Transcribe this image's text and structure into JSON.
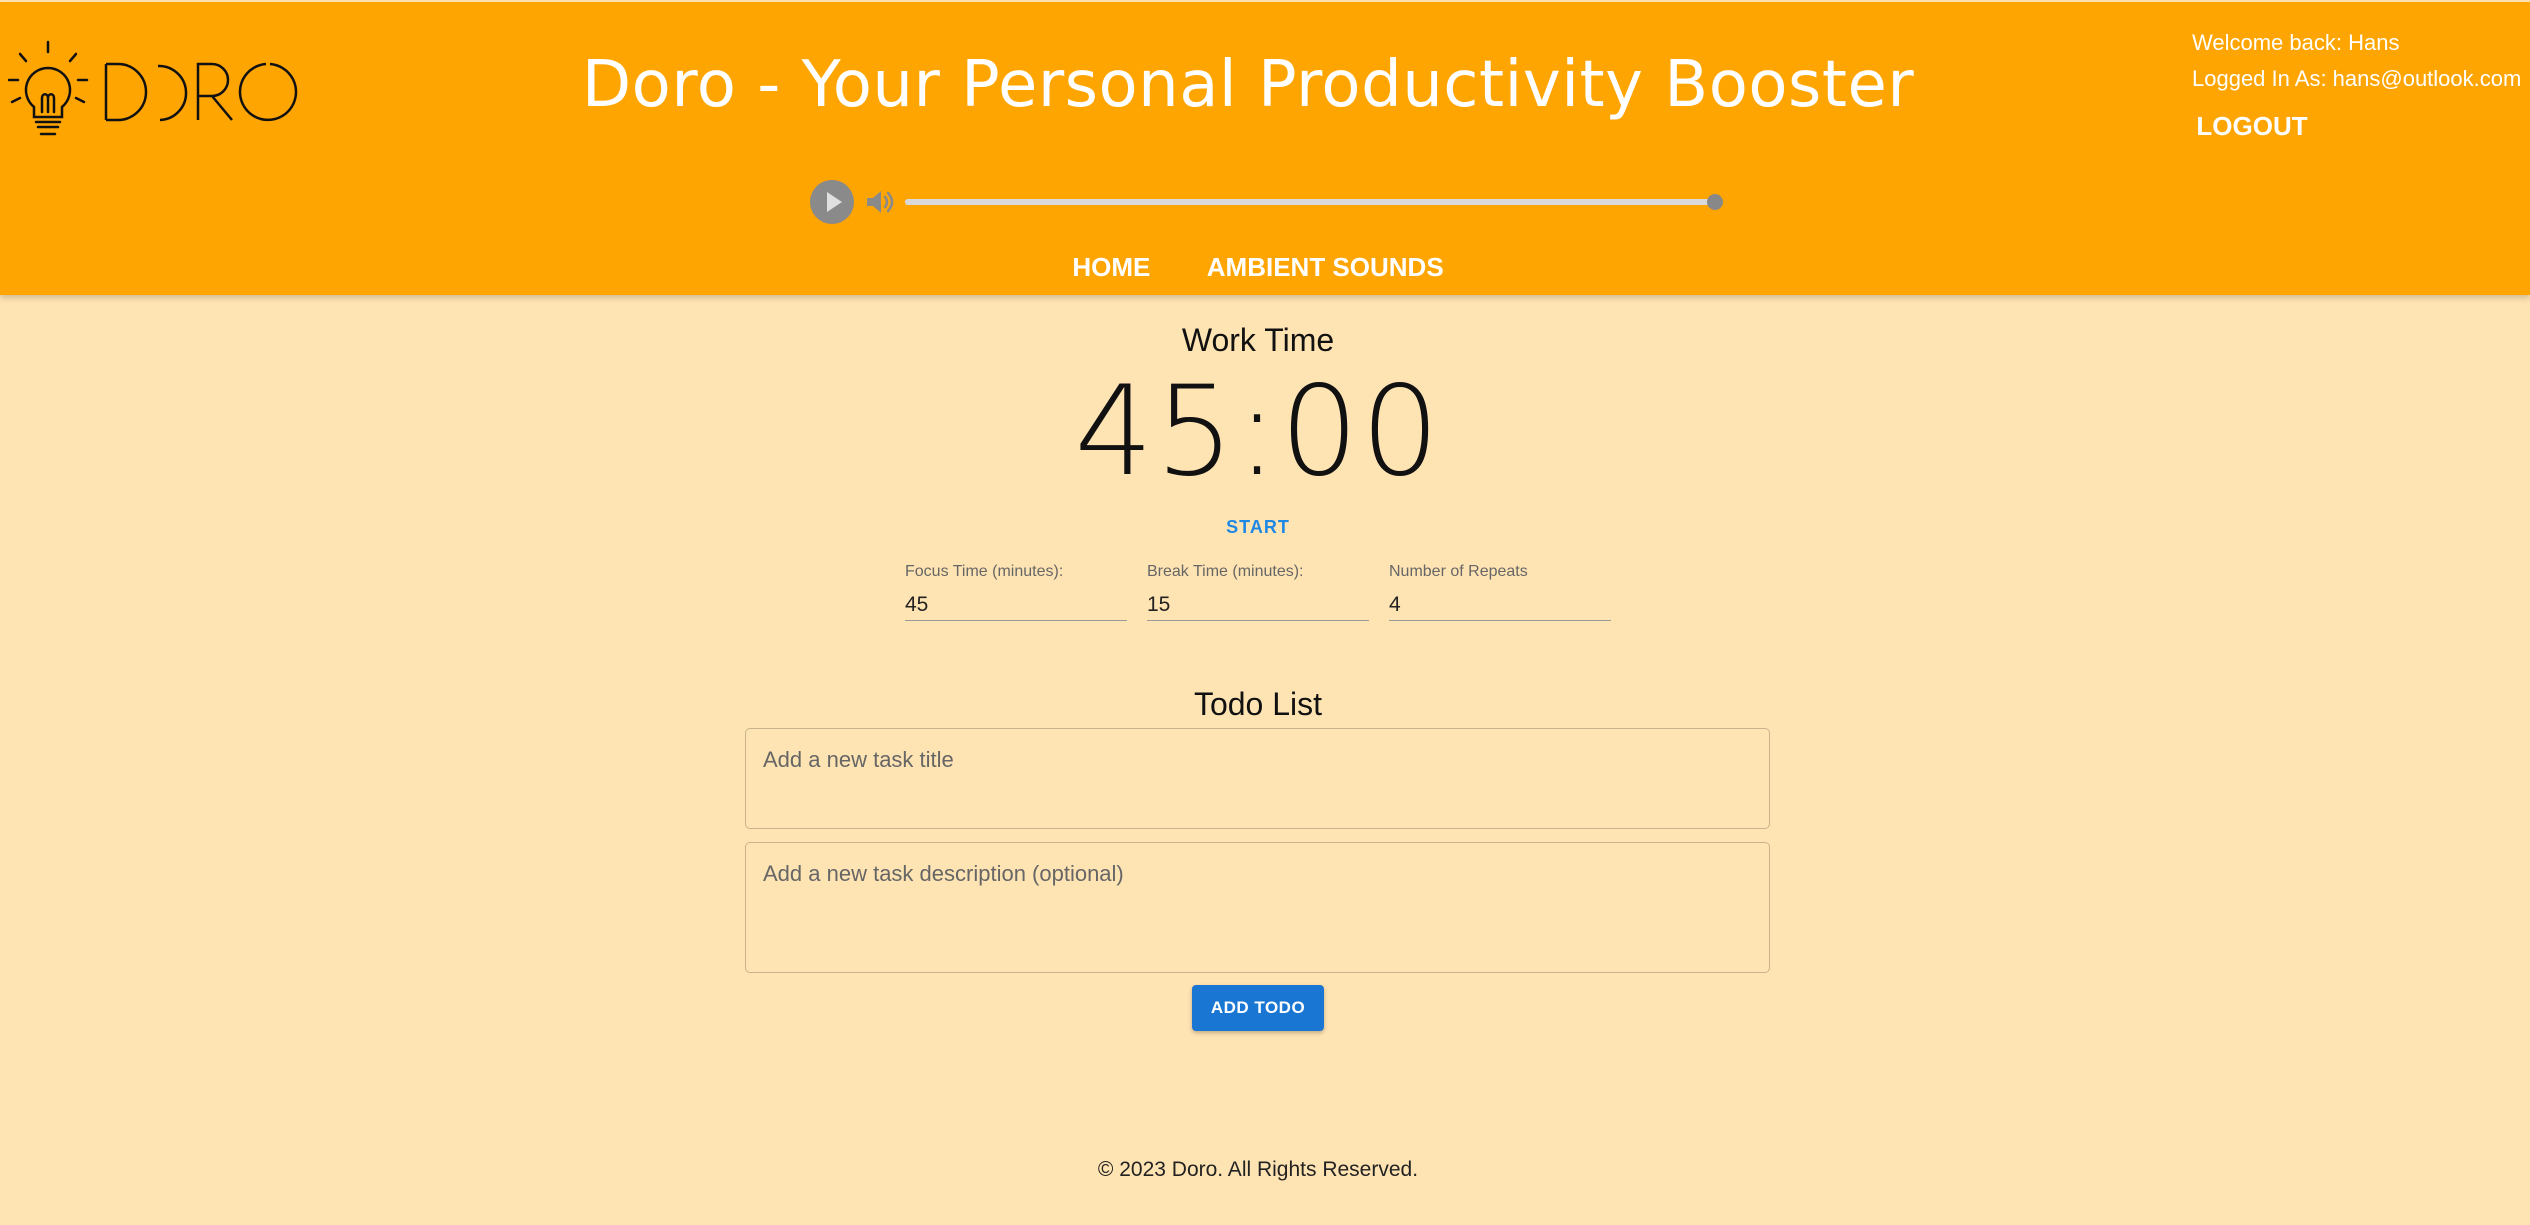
{
  "header": {
    "logo_text": "DORO",
    "title": "Doro - Your Personal Productivity Booster",
    "welcome_text": "Welcome back: Hans",
    "logged_in_text": "Logged In As: hans@outlook.com",
    "logout_label": "LOGOUT",
    "background_color": "#ffa502"
  },
  "player": {
    "play_icon": "play-icon",
    "volume_icon": "volume-icon",
    "volume_level": 1.0
  },
  "nav": {
    "items": [
      {
        "label": "HOME"
      },
      {
        "label": "AMBIENT SOUNDS"
      }
    ]
  },
  "timer": {
    "mode": "Work Time",
    "display": "45:00",
    "start_label": "START",
    "fields": [
      {
        "label": "Focus Time (minutes):",
        "value": "45"
      },
      {
        "label": "Break Time (minutes):",
        "value": "15"
      },
      {
        "label": "Number of Repeats",
        "value": "4"
      }
    ]
  },
  "todo": {
    "title": "Todo List",
    "title_placeholder": "Add a new task title",
    "description_placeholder": "Add a new task description (optional)",
    "add_label": "ADD TODO"
  },
  "footer": {
    "text": "© 2023 Doro. All Rights Reserved."
  },
  "colors": {
    "page_background": "#ffe4b3",
    "accent": "#1976d2"
  }
}
